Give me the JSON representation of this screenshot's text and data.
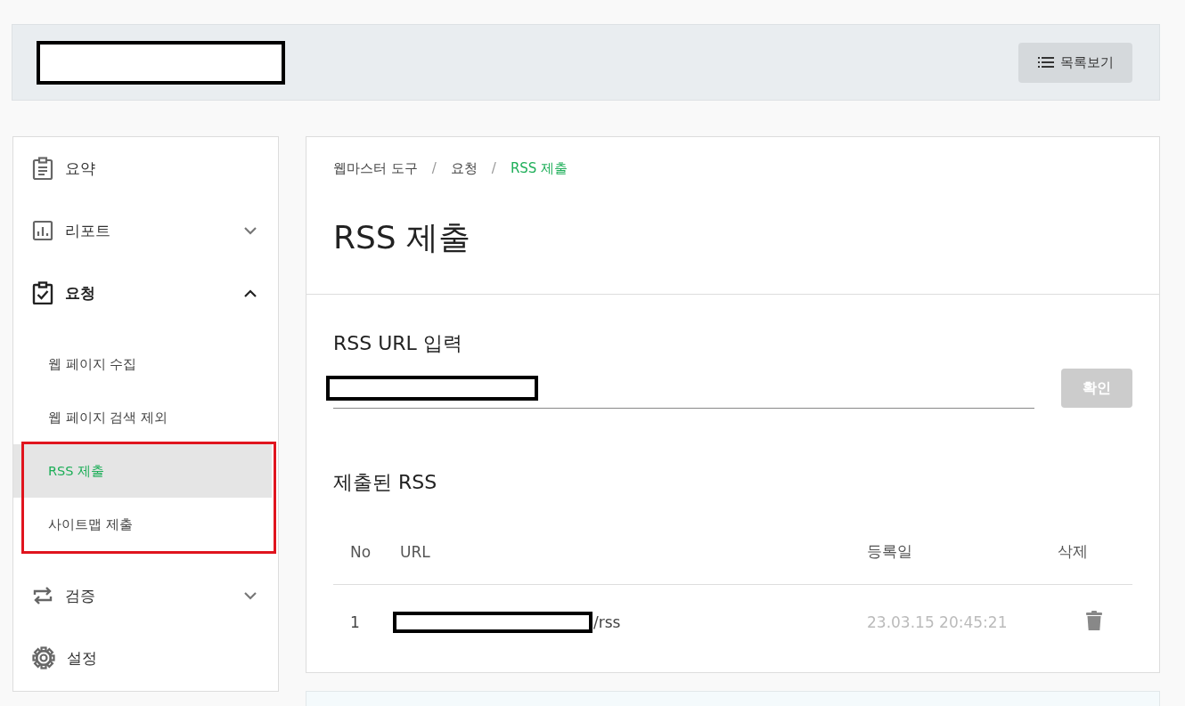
{
  "header": {
    "button": "목록보기"
  },
  "sidebar": {
    "items": [
      {
        "label": "요약",
        "selected": false
      },
      {
        "label": "리포트",
        "selected": false,
        "expanded": false
      },
      {
        "label": "요청",
        "selected": true,
        "expanded": true,
        "children": [
          {
            "label": "웹 페이지 수집",
            "selected": false,
            "annotated": false
          },
          {
            "label": "웹 페이지 검색 제외",
            "selected": false,
            "annotated": false
          },
          {
            "label": "RSS 제출",
            "selected": true,
            "annotated": true
          },
          {
            "label": "사이트맵 제출",
            "selected": false,
            "annotated": true
          }
        ]
      },
      {
        "label": "검증",
        "selected": false,
        "expanded": false
      },
      {
        "label": "설정",
        "selected": false
      }
    ]
  },
  "breadcrumb": [
    {
      "label": "웹마스터 도구",
      "selected": false
    },
    {
      "label": "요청",
      "selected": false
    },
    {
      "label": "RSS 제출",
      "selected": true
    }
  ],
  "breadcrumb_separator": "/",
  "page_title": "RSS 제출",
  "form": {
    "label": "RSS URL 입력",
    "button": "확인",
    "button_disabled": true
  },
  "table": {
    "title": "제출된 RSS",
    "columns": [
      "No",
      "URL",
      "등록일",
      "삭제"
    ],
    "rows": [
      {
        "no": "1",
        "url": "/rss",
        "date": "23.03.15 20:45:21"
      }
    ]
  }
}
